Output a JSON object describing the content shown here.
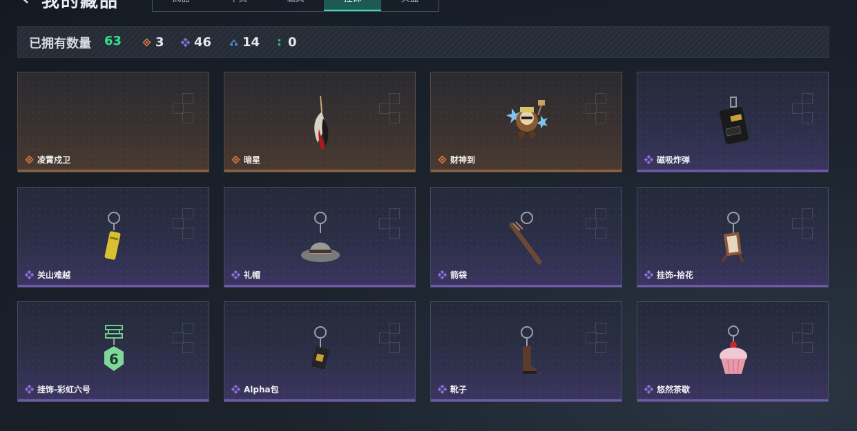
{
  "header": {
    "title": "我的藏品",
    "tabs": [
      {
        "label": "武器",
        "active": false
      },
      {
        "label": "干员",
        "active": false
      },
      {
        "label": "载具",
        "active": false
      },
      {
        "label": "挂饰",
        "active": true
      },
      {
        "label": "头盔",
        "active": false
      }
    ]
  },
  "summary": {
    "owned_label": "已拥有数量",
    "owned_count": "63",
    "rarity_counts": [
      {
        "icon": "orange-diamond-icon",
        "color": "#d9783f",
        "count": "3"
      },
      {
        "icon": "purple-diamond-icon",
        "color": "#8a6cd8",
        "count": "46"
      },
      {
        "icon": "blue-chevron-icon",
        "color": "#4b8fd8",
        "count": "14"
      },
      {
        "icon": "green-dots-icon",
        "color": "#38c88a",
        "count": "0"
      }
    ]
  },
  "items": [
    {
      "name": "凌霄戍卫",
      "rarity": "orange",
      "art": "empty"
    },
    {
      "name": "暗星",
      "rarity": "orange",
      "art": "feather-pendant"
    },
    {
      "name": "财神到",
      "rarity": "orange",
      "art": "fortune-god-figure"
    },
    {
      "name": "磁吸炸弹",
      "rarity": "purple",
      "art": "bomb-charm"
    },
    {
      "name": "关山难越",
      "rarity": "purple",
      "art": "yellow-can-charm"
    },
    {
      "name": "礼帽",
      "rarity": "purple",
      "art": "hat-charm"
    },
    {
      "name": "箭袋",
      "rarity": "purple",
      "art": "quiver-charm"
    },
    {
      "name": "挂饰-拾花",
      "rarity": "purple",
      "art": "flower-frame-charm"
    },
    {
      "name": "挂饰-彩虹六号",
      "rarity": "purple",
      "art": "rainbow-six-charm"
    },
    {
      "name": "Alpha包",
      "rarity": "purple",
      "art": "alpha-bag-charm"
    },
    {
      "name": "靴子",
      "rarity": "purple",
      "art": "boot-charm"
    },
    {
      "name": "悠然茶歇",
      "rarity": "purple",
      "art": "cupcake-charm"
    }
  ]
}
